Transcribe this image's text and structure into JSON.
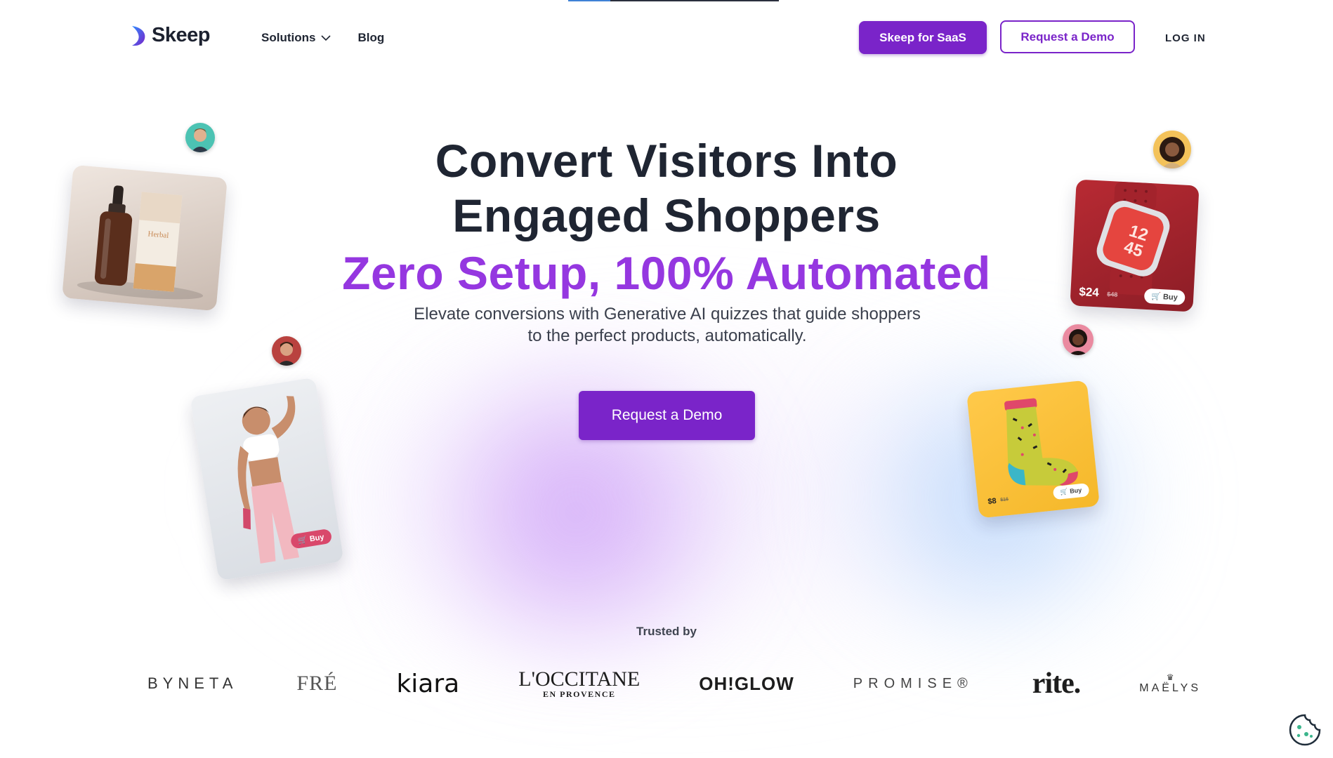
{
  "header": {
    "logo_text": "Skeep",
    "nav": [
      {
        "label": "Solutions",
        "has_dropdown": true
      },
      {
        "label": "Blog",
        "has_dropdown": false
      }
    ],
    "saas_button": "Skeep for SaaS",
    "demo_button": "Request a Demo",
    "login": "LOG IN"
  },
  "hero": {
    "title_line1": "Convert Visitors Into",
    "title_line2": "Engaged Shoppers",
    "subtitle": "Zero Setup, 100% Automated",
    "description_line1": "Elevate conversions with Generative AI quizzes that guide shoppers",
    "description_line2": "to the perfect products, automatically.",
    "cta": "Request a Demo"
  },
  "products": {
    "watch": {
      "price": "$24",
      "old_price": "$48",
      "buy": "Buy"
    },
    "sock": {
      "price": "$8",
      "old_price": "$16",
      "buy": "Buy"
    },
    "fitness": {
      "buy": "Buy"
    },
    "serum": {
      "box_text": "Herbal"
    }
  },
  "trusted": {
    "label": "Trusted by",
    "brands": [
      "BYNETA",
      "FRÉ",
      "kiara",
      "L'OCCITANE",
      "EN PROVENCE",
      "OH!GLOW",
      "PROMISE®",
      "rite.",
      "MAËLYS"
    ]
  },
  "colors": {
    "brand_purple": "#7a24c9",
    "accent_purple": "#9537e0",
    "text_dark": "#1f2532"
  },
  "icons": {
    "logo": "skeep-logo-icon",
    "dropdown": "chevron-down-icon",
    "cookie": "cookie-icon",
    "cart": "cart-icon"
  }
}
